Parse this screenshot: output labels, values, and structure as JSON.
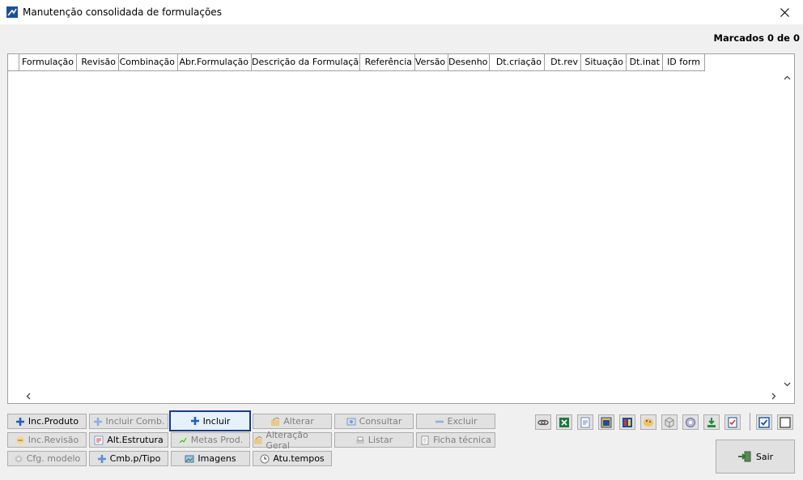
{
  "window": {
    "title": "Manutenção consolidada de formulações"
  },
  "marcados": "Marcados 0 de 0",
  "grid": {
    "columns": [
      "Formulação",
      "Revisão",
      "Combinação",
      "Abr.Formulação",
      "Descrição da Formulação",
      "Referência",
      "Versão",
      "Desenho",
      "Dt.criação",
      "Dt.rev",
      "Situação",
      "Dt.inat",
      "ID form"
    ]
  },
  "buttons": {
    "inc_produto": "Inc.Produto",
    "incluir_comb": "Incluir Comb.",
    "incluir": "Incluir",
    "alterar": "Alterar",
    "consultar": "Consultar",
    "excluir": "Excluir",
    "inc_revisao": "Inc.Revisão",
    "alt_estrutura": "Alt.Estrutura",
    "metas_prod": "Metas Prod.",
    "alteracao_geral": "Alteração Geral",
    "listar": "Listar",
    "ficha_tecnica": "Ficha técnica",
    "cfg_modelo": "Cfg. modelo",
    "cmb_tipo": "Cmb.p/Tipo",
    "imagens": "Imagens",
    "atu_tempos": "Atu.tempos",
    "sair": "Sair"
  },
  "colors": {
    "focus_border": "#1a3a8c",
    "plus_icon": "#1f5fbf",
    "disabled_text": "#808080"
  }
}
